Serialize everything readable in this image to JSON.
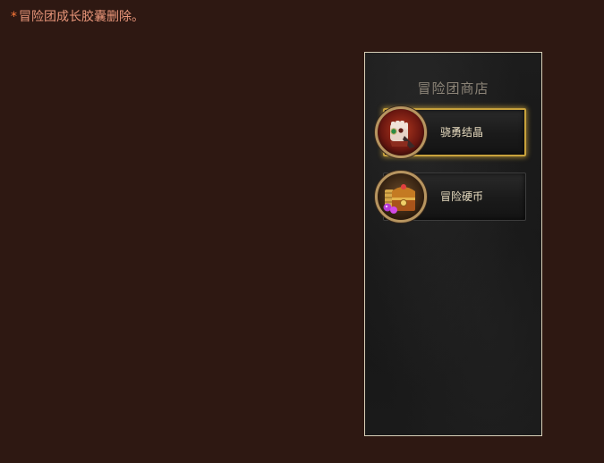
{
  "notice": {
    "star": "*",
    "text": "冒险团成长胶囊删除。"
  },
  "shop": {
    "title": "冒险团商店",
    "items": [
      {
        "label": "骁勇结晶",
        "icon": "fist-gauntlet-icon",
        "active": true
      },
      {
        "label": "冒险硬币",
        "icon": "treasure-chest-icon",
        "active": false
      }
    ]
  },
  "colors": {
    "background": "#2e1812",
    "notice_text": "#e9967a",
    "panel_border": "#d8cfb8",
    "active_border": "#c8a23c"
  }
}
